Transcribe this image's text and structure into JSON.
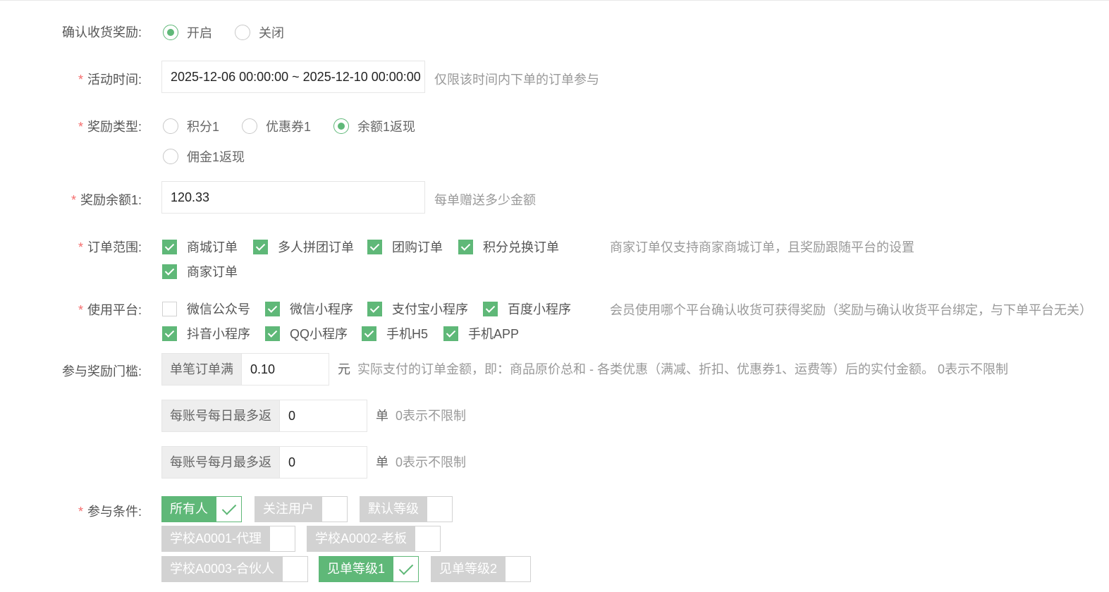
{
  "confirm_reward": {
    "label": "确认收货奖励:",
    "options": [
      {
        "label": "开启",
        "selected": true
      },
      {
        "label": "关闭",
        "selected": false
      }
    ]
  },
  "activity_time": {
    "required_mark": "*",
    "label": "活动时间:",
    "value": "2025-12-06 00:00:00 ~ 2025-12-10 00:00:00",
    "hint": "仅限该时间内下单的订单参与"
  },
  "reward_type": {
    "required_mark": "*",
    "label": "奖励类型:",
    "options": [
      {
        "label": "积分1",
        "selected": false
      },
      {
        "label": "优惠券1",
        "selected": false
      },
      {
        "label": "余额1返现",
        "selected": true
      },
      {
        "label": "佣金1返现",
        "selected": false
      }
    ]
  },
  "reward_balance": {
    "required_mark": "*",
    "label": "奖励余额1:",
    "value": "120.33",
    "hint": "每单赠送多少金额"
  },
  "order_scope": {
    "required_mark": "*",
    "label": "订单范围:",
    "items": [
      {
        "label": "商城订单",
        "checked": true
      },
      {
        "label": "多人拼团订单",
        "checked": true
      },
      {
        "label": "团购订单",
        "checked": true
      },
      {
        "label": "积分兑换订单",
        "checked": true
      },
      {
        "label": "商家订单",
        "checked": true
      }
    ],
    "hint": "商家订单仅支持商家商城订单，且奖励跟随平台的设置"
  },
  "platforms": {
    "required_mark": "*",
    "label": "使用平台:",
    "items": [
      {
        "label": "微信公众号",
        "checked": false
      },
      {
        "label": "微信小程序",
        "checked": true
      },
      {
        "label": "支付宝小程序",
        "checked": true
      },
      {
        "label": "百度小程序",
        "checked": true
      },
      {
        "label": "抖音小程序",
        "checked": true
      },
      {
        "label": "QQ小程序",
        "checked": true
      },
      {
        "label": "手机H5",
        "checked": true
      },
      {
        "label": "手机APP",
        "checked": true
      }
    ],
    "hint": "会员使用哪个平台确认收货可获得奖励（奖励与确认收货平台绑定，与下单平台无关）"
  },
  "threshold": {
    "label": "参与奖励门槛:",
    "rows": [
      {
        "prefix": "单笔订单满",
        "value": "0.10",
        "unit": "元",
        "hint": "实际支付的订单金额，即：商品原价总和 - 各类优惠（满减、折扣、优惠券1、运费等）后的实付金额。 0表示不限制"
      },
      {
        "prefix": "每账号每日最多返",
        "value": "0",
        "unit": "单",
        "hint": "0表示不限制"
      },
      {
        "prefix": "每账号每月最多返",
        "value": "0",
        "unit": "单",
        "hint": "0表示不限制"
      }
    ]
  },
  "conditions": {
    "required_mark": "*",
    "label": "参与条件:",
    "tags": [
      {
        "label": "所有人",
        "checked": true
      },
      {
        "label": "关注用户",
        "checked": false
      },
      {
        "label": "默认等级",
        "checked": false
      },
      {
        "label": "学校A0001-代理",
        "checked": false
      },
      {
        "label": "学校A0002-老板",
        "checked": false
      },
      {
        "label": "学校A0003-合伙人",
        "checked": false
      },
      {
        "label": "见单等级1",
        "checked": true
      },
      {
        "label": "见单等级2",
        "checked": false
      }
    ]
  },
  "colors": {
    "accent": "#5fb878",
    "required": "#f56c6c",
    "tag_off": "#d2d2d2",
    "hint": "#999999"
  }
}
